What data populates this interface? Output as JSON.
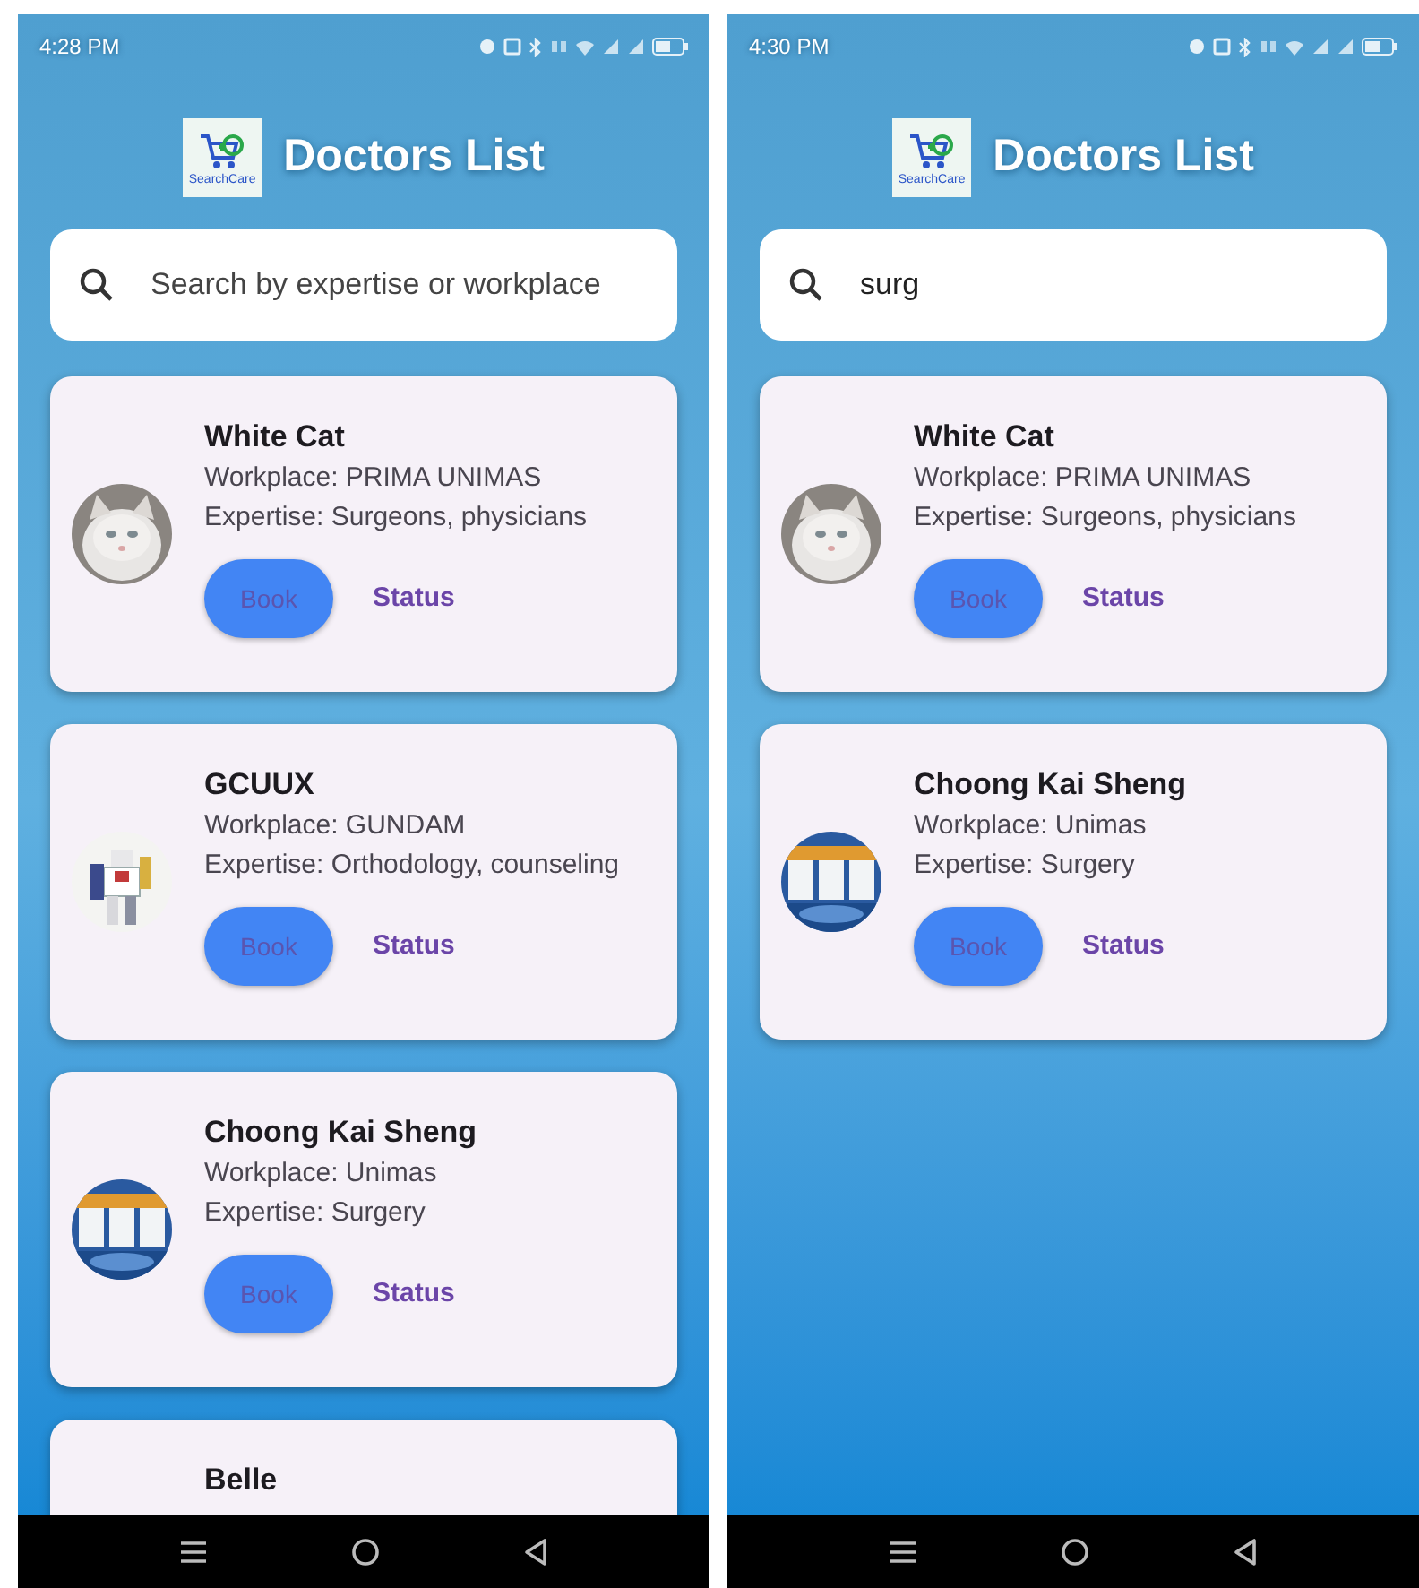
{
  "screens": [
    {
      "status_bar": {
        "time": "4:28 PM"
      },
      "logo_text": "SearchCare",
      "title": "Doctors List",
      "search": {
        "placeholder": "Search by expertise or workplace"
      },
      "doctors": [
        {
          "name": "White Cat",
          "workplace": "Workplace: PRIMA UNIMAS",
          "expertise": "Expertise: Surgeons, physicians",
          "book": "Book",
          "status": "Status"
        },
        {
          "name": "GCUUX",
          "workplace": "Workplace: GUNDAM",
          "expertise": "Expertise: Orthodology, counseling",
          "book": "Book",
          "status": "Status"
        },
        {
          "name": "Choong Kai Sheng",
          "workplace": "Workplace: Unimas",
          "expertise": "Expertise: Surgery",
          "book": "Book",
          "status": "Status"
        },
        {
          "name": "Belle"
        }
      ]
    },
    {
      "status_bar": {
        "time": "4:30 PM"
      },
      "logo_text": "SearchCare",
      "title": "Doctors List",
      "search": {
        "value": "surg"
      },
      "doctors": [
        {
          "name": "White Cat",
          "workplace": "Workplace: PRIMA UNIMAS",
          "expertise": "Expertise: Surgeons, physicians",
          "book": "Book",
          "status": "Status"
        },
        {
          "name": "Choong Kai Sheng",
          "workplace": "Workplace: Unimas",
          "expertise": "Expertise: Surgery",
          "book": "Book",
          "status": "Status"
        }
      ]
    }
  ]
}
